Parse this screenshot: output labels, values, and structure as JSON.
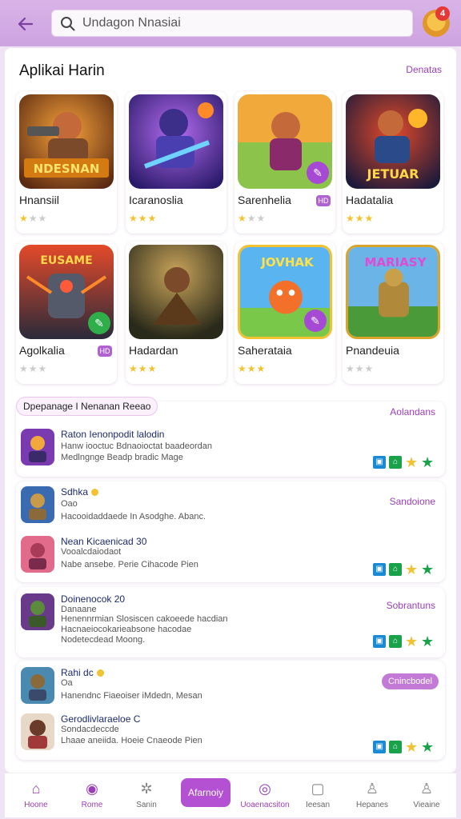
{
  "header": {
    "search_placeholder": "Undagon Nnasiai",
    "notification_count": "4"
  },
  "featured": {
    "title": "Aplikai Harin",
    "link": "Denatas",
    "apps": [
      {
        "name": "Hnansiil",
        "rating": "★★★",
        "art": "NDESNAN",
        "badge": ""
      },
      {
        "name": "Icaranoslia",
        "rating": "★★★",
        "art": "",
        "badge": ""
      },
      {
        "name": "Sarenhelia",
        "rating": "★★★",
        "art": "",
        "badge": "HD"
      },
      {
        "name": "Hadatalia",
        "rating": "★★★",
        "art": "JETUAR",
        "badge": ""
      },
      {
        "name": "Agolkalia",
        "rating": "★★★",
        "art": "EUSAME",
        "badge": "HD"
      },
      {
        "name": "Hadardan",
        "rating": "★★★",
        "art": "",
        "badge": ""
      },
      {
        "name": "Saherataia",
        "rating": "★★★",
        "art": "JOVHAK",
        "badge": ""
      },
      {
        "name": "Pnandeuia",
        "rating": "★★★",
        "art": "MARIASY",
        "badge": ""
      }
    ]
  },
  "lists": [
    {
      "chip": "Dpepanage I Nenanan Reeao",
      "link": "Aolandans",
      "rows": [
        {
          "title": "Raton Ienonpodit lalodin",
          "lines": [
            "Hanw iooctuc Bdnaoioctat baadeordan",
            "Medlngnge Beadp bradic Mage"
          ],
          "dot": false,
          "icons": true
        }
      ]
    },
    {
      "chip": "",
      "link": "Sandoione",
      "rows": [
        {
          "title": "Sdhka",
          "lines": [
            "Oao",
            "Hacooidaddaede In Asodghe. Abanc."
          ],
          "dot": true,
          "icons": false
        },
        {
          "title": "Nean Kicaenicad 30",
          "lines": [
            "Vooalcdaiodaot",
            "Nabe ansebe. Perie Cihacode Pien"
          ],
          "dot": false,
          "icons": true
        }
      ]
    },
    {
      "chip": "",
      "link": "Sobrantuns",
      "rows": [
        {
          "title": "Doinenocok 20",
          "lines": [
            "Danaane",
            "Henennrmian Slosiscen cakoeede hacdian",
            "Hacnaeiocokarieabsone hacodae",
            "Nodetecdead Moong."
          ],
          "dot": false,
          "icons": true
        }
      ]
    },
    {
      "chip": "",
      "pill": "Cnincbodel",
      "rows": [
        {
          "title": "Rahi dc",
          "lines": [
            "Oa",
            "Hanendnc Fiaeoiser iMdedn, Mesan"
          ],
          "dot": true,
          "icons": false
        },
        {
          "title": "Gerodlivlaraeloe C",
          "lines": [
            "Sondacdeccde",
            "Lhaae aneiida. Hoeie Cnaeode Pien"
          ],
          "dot": false,
          "icons": true
        }
      ]
    }
  ],
  "nav": {
    "items": [
      "Hoone",
      "Rome",
      "Sanin",
      "Uoaenacsiton",
      "Ieesan",
      "Hepanes",
      "Vieaine"
    ],
    "center": "Afarnoiy"
  },
  "colors": {
    "accent": "#9b3fb8",
    "header": "#d9b3e8",
    "center_button": "#b450d2"
  }
}
